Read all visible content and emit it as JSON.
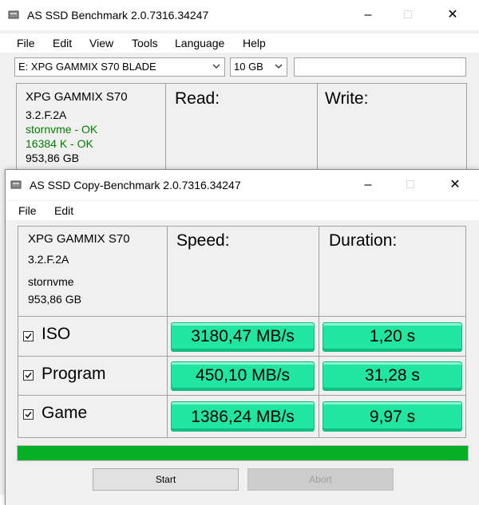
{
  "main_window": {
    "title": "AS SSD Benchmark 2.0.7316.34247",
    "menu": [
      "File",
      "Edit",
      "View",
      "Tools",
      "Language",
      "Help"
    ],
    "drive_select": "E: XPG GAMMIX S70 BLADE",
    "size_select": "10 GB",
    "search_value": "",
    "drive_info": {
      "model": "XPG GAMMIX S70",
      "firmware": "3.2.F.2A",
      "driver": "stornvme - OK",
      "alignment": "16384 K - OK",
      "capacity": "953,86 GB"
    },
    "headers": {
      "read": "Read:",
      "write": "Write:"
    }
  },
  "copy_window": {
    "title": "AS SSD Copy-Benchmark 2.0.7316.34247",
    "menu": [
      "File",
      "Edit"
    ],
    "drive_info": {
      "model": "XPG GAMMIX S70",
      "firmware": "3.2.F.2A",
      "driver": "stornvme",
      "capacity": "953,86 GB"
    },
    "headers": {
      "speed": "Speed:",
      "duration": "Duration:"
    },
    "rows": [
      {
        "label": "ISO",
        "checked": true,
        "speed": "3180,47 MB/s",
        "duration": "1,20 s"
      },
      {
        "label": "Program",
        "checked": true,
        "speed": "450,10 MB/s",
        "duration": "31,28 s"
      },
      {
        "label": "Game",
        "checked": true,
        "speed": "1386,24 MB/s",
        "duration": "9,97 s"
      }
    ],
    "progress": 1.0,
    "buttons": {
      "start": "Start",
      "abort": "Abort"
    }
  },
  "colors": {
    "result_fill": "#20e6a2",
    "progress_fill": "#06b025",
    "ok_text": "#008000"
  },
  "icons": {
    "app": "drive-icon",
    "minimize": "minimize-icon",
    "maximize": "maximize-icon",
    "close": "close-icon",
    "dropdown": "chevron-down-icon",
    "check": "check-icon"
  }
}
